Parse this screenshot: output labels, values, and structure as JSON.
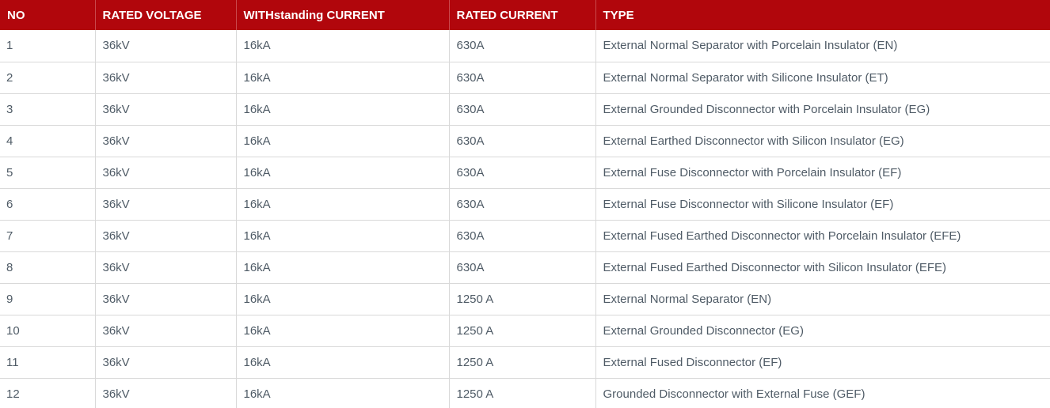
{
  "table": {
    "headers": [
      "NO",
      "RATED VOLTAGE",
      "WITHstanding CURRENT",
      "RATED CURRENT",
      "TYPE"
    ],
    "rows": [
      [
        "1",
        "36kV",
        "16kA",
        "630A",
        "External Normal Separator with Porcelain Insulator (EN)"
      ],
      [
        "2",
        "36kV",
        "16kA",
        "630A",
        "External Normal Separator with Silicone Insulator (ET)"
      ],
      [
        "3",
        "36kV",
        "16kA",
        "630A",
        "External Grounded Disconnector with Porcelain Insulator (EG)"
      ],
      [
        "4",
        "36kV",
        "16kA",
        "630A",
        "External Earthed Disconnector with Silicon Insulator (EG)"
      ],
      [
        "5",
        "36kV",
        "16kA",
        "630A",
        "External Fuse Disconnector with Porcelain Insulator (EF)"
      ],
      [
        "6",
        "36kV",
        "16kA",
        "630A",
        "External Fuse Disconnector with Silicone Insulator (EF)"
      ],
      [
        "7",
        "36kV",
        "16kA",
        "630A",
        "External Fused Earthed Disconnector with Porcelain Insulator (EFE)"
      ],
      [
        "8",
        "36kV",
        "16kA",
        "630A",
        "External Fused Earthed Disconnector with Silicon Insulator (EFE)"
      ],
      [
        "9",
        "36kV",
        "16kA",
        "1250 A",
        "External Normal Separator (EN)"
      ],
      [
        "10",
        "36kV",
        "16kA",
        "1250 A",
        "External Grounded Disconnector (EG)"
      ],
      [
        "11",
        "36kV",
        "16kA",
        "1250 A",
        "External Fused Disconnector (EF)"
      ],
      [
        "12",
        "36kV",
        "16kA",
        "1250 A",
        "Grounded Disconnector with External Fuse (GEF)"
      ]
    ]
  },
  "colors": {
    "header_background": "#b1060c",
    "header_text": "#ffffff",
    "cell_text": "#4f5b66",
    "grid_line": "#d9d9d9"
  }
}
